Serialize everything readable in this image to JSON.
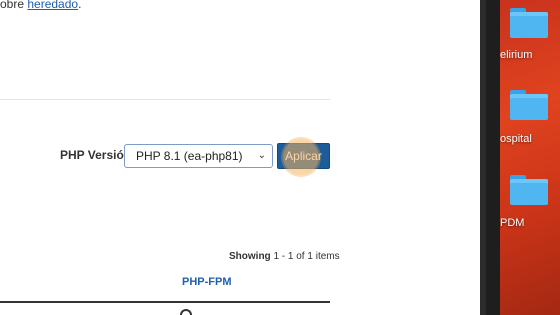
{
  "page": {
    "top_text_prefix": "obre ",
    "top_text_link": "heredado",
    "top_text_suffix": ".",
    "php_version_label": "PHP Versión",
    "php_select_value": "PHP 8.1 (ea-php81)",
    "apply_button_label": "Aplicar",
    "showing_label": "Showing",
    "showing_range": "1 - 1",
    "showing_of": "of",
    "showing_total": "1",
    "showing_items": "items",
    "column_header": "PHP-FPM"
  },
  "desktop": {
    "folders": [
      {
        "label": "elirium",
        "icon": "folder-icon"
      },
      {
        "label": "ospital",
        "icon": "folder-icon"
      },
      {
        "label": "PDM",
        "icon": "folder-icon"
      }
    ]
  },
  "colors": {
    "link": "#1f5fae",
    "button_bg": "#1d5c9a",
    "desktop_bg": "#d23a1b",
    "folder": "#4fb6f2",
    "click_highlight": "#f6b25c"
  }
}
